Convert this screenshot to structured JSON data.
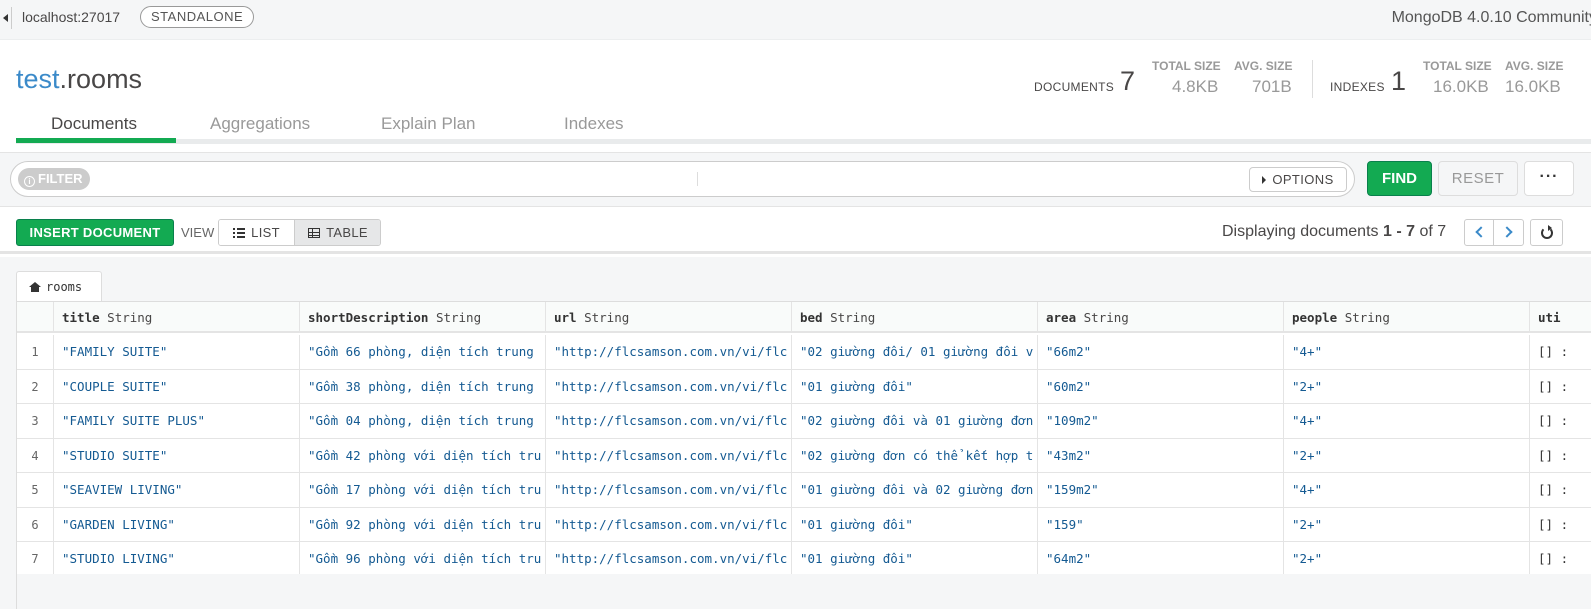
{
  "topbar": {
    "host": "localhost:27017",
    "topology": "STANDALONE",
    "version": "MongoDB 4.0.10 Community"
  },
  "collection": {
    "db": "test",
    "sep": ".",
    "name": "rooms"
  },
  "stats": {
    "documents_label": "DOCUMENTS",
    "documents_count": "7",
    "doc_total_size_label": "TOTAL SIZE",
    "doc_total_size": "4.8KB",
    "doc_avg_size_label": "AVG. SIZE",
    "doc_avg_size": "701B",
    "indexes_label": "INDEXES",
    "indexes_count": "1",
    "idx_total_size_label": "TOTAL SIZE",
    "idx_total_size": "16.0KB",
    "idx_avg_size_label": "AVG. SIZE",
    "idx_avg_size": "16.0KB"
  },
  "tabs": [
    {
      "label": "Documents",
      "active": true
    },
    {
      "label": "Aggregations"
    },
    {
      "label": "Explain Plan"
    },
    {
      "label": "Indexes"
    }
  ],
  "filter": {
    "pill": "FILTER",
    "value": "",
    "options_label": "OPTIONS",
    "find_label": "FIND",
    "reset_label": "RESET",
    "more_label": "···"
  },
  "actions": {
    "insert_label": "INSERT DOCUMENT",
    "view_label": "VIEW",
    "list_label": "LIST",
    "table_label": "TABLE",
    "displaying_prefix": "Displaying documents",
    "range": "1 - 7",
    "of_text": "of",
    "total": "7"
  },
  "table": {
    "breadcrumb": "rooms",
    "columns": [
      {
        "name": "title",
        "type": "String"
      },
      {
        "name": "shortDescription",
        "type": "String"
      },
      {
        "name": "url",
        "type": "String"
      },
      {
        "name": "bed",
        "type": "String"
      },
      {
        "name": "area",
        "type": "String"
      },
      {
        "name": "people",
        "type": "String"
      },
      {
        "name": "uti",
        "type": ""
      }
    ],
    "rows": [
      {
        "idx": "1",
        "title": "\"FAMILY SUITE\"",
        "shortDescription": "\"Gồm 66 phòng, diện tích trung",
        "url": "\"http://flcsamson.com.vn/vi/flc",
        "bed": "\"02 giường đôi/ 01 giường đôi v",
        "area": "\"66m2\"",
        "people": "\"4+\"",
        "uti": "[] :"
      },
      {
        "idx": "2",
        "title": "\"COUPLE SUITE\"",
        "shortDescription": "\"Gồm 38 phòng, diện tích trung",
        "url": "\"http://flcsamson.com.vn/vi/flc",
        "bed": "\"01 giường đôi\"",
        "area": "\"60m2\"",
        "people": "\"2+\"",
        "uti": "[] :"
      },
      {
        "idx": "3",
        "title": "\"FAMILY SUITE PLUS\"",
        "shortDescription": "\"Gồm 04 phòng, diện tích trung",
        "url": "\"http://flcsamson.com.vn/vi/flc",
        "bed": "\"02 giường đôi và 01 giường đơn",
        "area": "\"109m2\"",
        "people": "\"4+\"",
        "uti": "[] :"
      },
      {
        "idx": "4",
        "title": "\"STUDIO SUITE\"",
        "shortDescription": "\"Gồm 42 phòng với diện tích tru",
        "url": "\"http://flcsamson.com.vn/vi/flc",
        "bed": "\"02 giường đơn có thể kết hợp t",
        "area": "\"43m2\"",
        "people": "\"2+\"",
        "uti": "[] :"
      },
      {
        "idx": "5",
        "title": "\"SEAVIEW LIVING\"",
        "shortDescription": "\"Gồm 17 phòng với diện tích tru",
        "url": "\"http://flcsamson.com.vn/vi/flc",
        "bed": "\"01 giường đôi và 02 giường đơn",
        "area": "\"159m2\"",
        "people": "\"4+\"",
        "uti": "[] :"
      },
      {
        "idx": "6",
        "title": "\"GARDEN LIVING\"",
        "shortDescription": "\"Gồm 92 phòng với diện tích tru",
        "url": "\"http://flcsamson.com.vn/vi/flc",
        "bed": "\"01 giường đôi\"",
        "area": "\"159\"",
        "people": "\"2+\"",
        "uti": "[] :"
      },
      {
        "idx": "7",
        "title": "\"STUDIO LIVING\"",
        "shortDescription": "\"Gồm 96 phòng với diện tích tru",
        "url": "\"http://flcsamson.com.vn/vi/flc",
        "bed": "\"01 giường đôi\"",
        "area": "\"64m2\"",
        "people": "\"2+\"",
        "uti": "[] :"
      }
    ]
  },
  "colors": {
    "accent_green": "#13aa52",
    "db_blue": "#3b8ac9",
    "value_blue": "#145a92"
  }
}
